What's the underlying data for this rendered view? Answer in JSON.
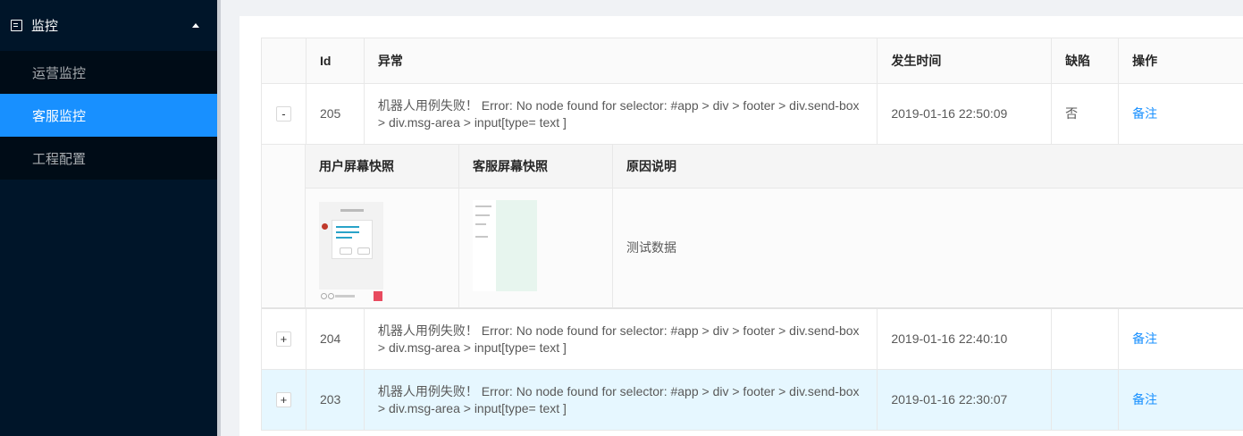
{
  "sidebar": {
    "group_label": "监控",
    "items": [
      {
        "label": "运营监控",
        "active": false
      },
      {
        "label": "客服监控",
        "active": true
      },
      {
        "label": "工程配置",
        "active": false
      }
    ]
  },
  "table": {
    "headers": [
      "Id",
      "异常",
      "发生时间",
      "缺陷",
      "操作"
    ],
    "rows": [
      {
        "toggle": "-",
        "id": "205",
        "error": "机器人用例失败！ Error: No node found for selector: #app > div > footer > div.send-box > div.msg-area > input[type= text ]",
        "time": "2019-01-16 22:50:09",
        "defect": "否",
        "action": "备注"
      },
      {
        "toggle": "+",
        "id": "204",
        "error": "机器人用例失败！ Error: No node found for selector: #app > div > footer > div.send-box > div.msg-area > input[type= text ]",
        "time": "2019-01-16 22:40:10",
        "defect": "",
        "action": "备注"
      },
      {
        "toggle": "+",
        "id": "203",
        "error": "机器人用例失败！ Error: No node found for selector: #app > div > footer > div.send-box > div.msg-area > input[type= text ]",
        "time": "2019-01-16 22:30:07",
        "defect": "",
        "action": "备注"
      }
    ],
    "expanded": {
      "headers": [
        "用户屏幕快照",
        "客服屏幕快照",
        "原因说明"
      ],
      "reason": "测试数据"
    }
  },
  "colors": {
    "sidebar_bg": "#001529",
    "active": "#1890ff",
    "highlight_row": "#e6f7ff"
  }
}
